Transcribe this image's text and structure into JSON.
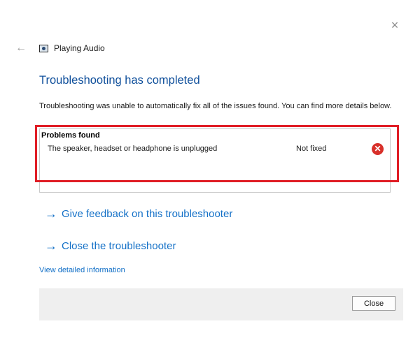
{
  "window": {
    "title": "Playing Audio",
    "close_glyph": "×",
    "back_glyph": "←"
  },
  "main": {
    "heading": "Troubleshooting has completed",
    "description": "Troubleshooting was unable to automatically fix all of the issues found. You can find more details below."
  },
  "problems": {
    "title": "Problems found",
    "items": [
      {
        "text": "The speaker, headset or headphone is unplugged",
        "status": "Not fixed",
        "icon": "error-icon"
      }
    ]
  },
  "links": {
    "feedback": "Give feedback on this troubleshooter",
    "close_troubleshooter": "Close the troubleshooter",
    "details": "View detailed information",
    "arrow_glyph": "→"
  },
  "footer": {
    "close_label": "Close"
  },
  "colors": {
    "heading": "#0f4f9b",
    "link": "#1370c7",
    "highlight": "#e01e26",
    "error": "#d8302a"
  }
}
